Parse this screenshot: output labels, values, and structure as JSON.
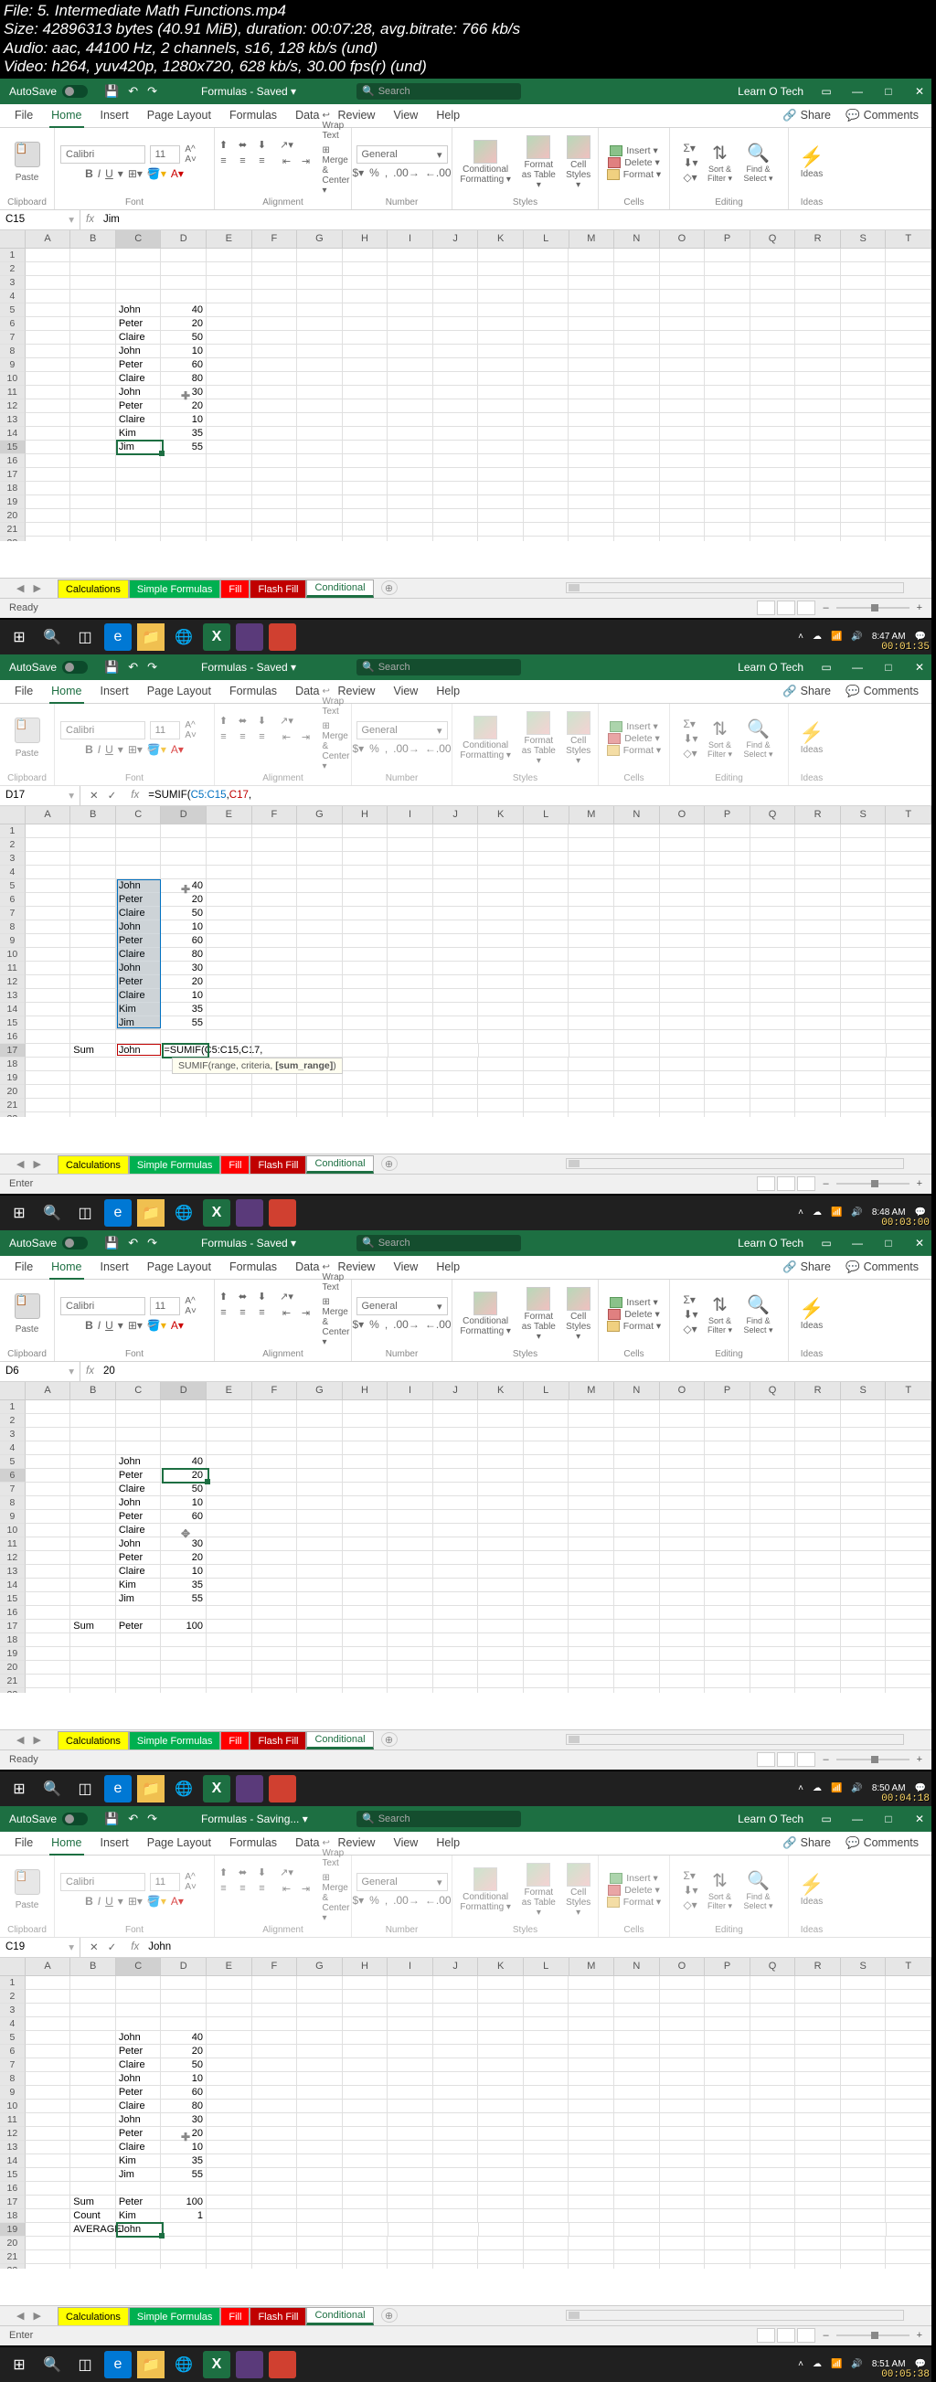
{
  "video_meta": {
    "file": "File: 5. Intermediate Math Functions.mp4",
    "size": "Size: 42896313 bytes (40.91 MiB), duration: 00:07:28, avg.bitrate: 766 kb/s",
    "audio": "Audio: aac, 44100 Hz, 2 channels, s16, 128 kb/s (und)",
    "video": "Video: h264, yuv420p, 1280x720, 628 kb/s, 30.00 fps(r) (und)"
  },
  "common": {
    "autosave_label": "AutoSave",
    "doc_title": "Formulas - Saved ▾",
    "doc_title_saving": "Formulas - Saving... ▾",
    "search_placeholder": "Search",
    "account": "Learn O Tech",
    "share_label": "Share",
    "comments_label": "Comments",
    "tabs": [
      "File",
      "Home",
      "Insert",
      "Page Layout",
      "Formulas",
      "Data",
      "Review",
      "View",
      "Help"
    ],
    "sheet_tabs": [
      "Calculations",
      "Simple Formulas",
      "Fill",
      "Flash Fill",
      "Conditional"
    ],
    "ribbon_groups": {
      "clipboard": "Clipboard",
      "font": "Font",
      "alignment": "Alignment",
      "number": "Number",
      "styles": "Styles",
      "cells": "Cells",
      "editing": "Editing",
      "ideas": "Ideas"
    },
    "font_name": "Calibri",
    "font_size": "11",
    "number_fmt": "General",
    "wrap_text": "Wrap Text",
    "merge_center": "Merge & Center",
    "cond_fmt": "Conditional Formatting ▾",
    "fmt_table": "Format as Table ▾",
    "cell_styles": "Cell Styles ▾",
    "insert_c": "Insert ▾",
    "delete_c": "Delete ▾",
    "format_c": "Format ▾",
    "sort_filter": "Sort & Filter ▾",
    "find_select": "Find & Select ▾",
    "ideas_btn": "Ideas",
    "paste": "Paste"
  },
  "cols": [
    "A",
    "B",
    "C",
    "D",
    "E",
    "F",
    "G",
    "H",
    "I",
    "J",
    "K",
    "L",
    "M",
    "N",
    "O",
    "P",
    "Q",
    "R",
    "S",
    "T"
  ],
  "panel1": {
    "namebox": "C15",
    "formula": "Jim",
    "active": {
      "col": 2,
      "row": 14,
      "w": 1
    },
    "cursor": {
      "col": 3,
      "row": 10
    },
    "data_rows": [
      {
        "r": 5,
        "c": "John",
        "d": "40"
      },
      {
        "r": 6,
        "c": "Peter",
        "d": "20"
      },
      {
        "r": 7,
        "c": "Claire",
        "d": "50"
      },
      {
        "r": 8,
        "c": "John",
        "d": "10"
      },
      {
        "r": 9,
        "c": "Peter",
        "d": "60"
      },
      {
        "r": 10,
        "c": "Claire",
        "d": "80"
      },
      {
        "r": 11,
        "c": "John",
        "d": "30"
      },
      {
        "r": 12,
        "c": "Peter",
        "d": "20"
      },
      {
        "r": 13,
        "c": "Claire",
        "d": "10"
      },
      {
        "r": 14,
        "c": "Kim",
        "d": "35"
      },
      {
        "r": 15,
        "c": "Jim",
        "d": "55"
      }
    ],
    "status": "Ready",
    "time": "8:47 AM",
    "vidtime": "00:01:35"
  },
  "panel2": {
    "namebox": "D17",
    "formula_parts": {
      "pre": "=SUMIF(",
      "r1": "C5:C15",
      "mid": ",",
      "r2": "C17",
      "post": ","
    },
    "tip": {
      "fn": "SUMIF",
      "sig": "(range, criteria, ",
      "bold": "[sum_range]",
      "end": ")"
    },
    "active": {
      "col": 3,
      "row": 16,
      "editing": true
    },
    "blue_range": {
      "col": 2,
      "row": 4,
      "rows": 11
    },
    "red_range": {
      "col": 2,
      "row": 16,
      "rows": 1
    },
    "cursor": {
      "col": 3,
      "row": 4
    },
    "data_rows": [
      {
        "r": 5,
        "c": "John",
        "d": "40"
      },
      {
        "r": 6,
        "c": "Peter",
        "d": "20"
      },
      {
        "r": 7,
        "c": "Claire",
        "d": "50"
      },
      {
        "r": 8,
        "c": "John",
        "d": "10"
      },
      {
        "r": 9,
        "c": "Peter",
        "d": "60"
      },
      {
        "r": 10,
        "c": "Claire",
        "d": "80"
      },
      {
        "r": 11,
        "c": "John",
        "d": "30"
      },
      {
        "r": 12,
        "c": "Peter",
        "d": "20"
      },
      {
        "r": 13,
        "c": "Claire",
        "d": "10"
      },
      {
        "r": 14,
        "c": "Kim",
        "d": "35"
      },
      {
        "r": 15,
        "c": "Jim",
        "d": "55"
      },
      {
        "r": 17,
        "b": "Sum",
        "c": "John",
        "d_formula": "=SUMIF(C5:C15,C17,"
      }
    ],
    "status": "Enter",
    "time": "8:48 AM",
    "vidtime": "00:03:00"
  },
  "panel3": {
    "namebox": "D6",
    "formula": "20",
    "active": {
      "col": 3,
      "row": 5
    },
    "cursor_move": {
      "col": 3,
      "row": 9
    },
    "data_rows": [
      {
        "r": 5,
        "c": "John",
        "d": "40"
      },
      {
        "r": 6,
        "c": "Peter",
        "d": "20"
      },
      {
        "r": 7,
        "c": "Claire",
        "d": "50"
      },
      {
        "r": 8,
        "c": "John",
        "d": "10"
      },
      {
        "r": 9,
        "c": "Peter",
        "d": "60"
      },
      {
        "r": 10,
        "c": "Claire",
        "d": ""
      },
      {
        "r": 11,
        "c": "John",
        "d": "30"
      },
      {
        "r": 12,
        "c": "Peter",
        "d": "20"
      },
      {
        "r": 13,
        "c": "Claire",
        "d": "10"
      },
      {
        "r": 14,
        "c": "Kim",
        "d": "35"
      },
      {
        "r": 15,
        "c": "Jim",
        "d": "55"
      },
      {
        "r": 17,
        "b": "Sum",
        "c": "Peter",
        "d": "100"
      }
    ],
    "status": "Ready",
    "time": "8:50 AM",
    "vidtime": "00:04:18"
  },
  "panel4": {
    "namebox": "C19",
    "formula": "John",
    "active": {
      "col": 2,
      "row": 18
    },
    "cursor": {
      "col": 3,
      "row": 11
    },
    "data_rows": [
      {
        "r": 5,
        "c": "John",
        "d": "40"
      },
      {
        "r": 6,
        "c": "Peter",
        "d": "20"
      },
      {
        "r": 7,
        "c": "Claire",
        "d": "50"
      },
      {
        "r": 8,
        "c": "John",
        "d": "10"
      },
      {
        "r": 9,
        "c": "Peter",
        "d": "60"
      },
      {
        "r": 10,
        "c": "Claire",
        "d": "80"
      },
      {
        "r": 11,
        "c": "John",
        "d": "30"
      },
      {
        "r": 12,
        "c": "Peter",
        "d": "20"
      },
      {
        "r": 13,
        "c": "Claire",
        "d": "10"
      },
      {
        "r": 14,
        "c": "Kim",
        "d": "35"
      },
      {
        "r": 15,
        "c": "Jim",
        "d": "55"
      },
      {
        "r": 17,
        "b": "Sum",
        "c": "Peter",
        "d": "100"
      },
      {
        "r": 18,
        "b": "Count",
        "c": "Kim",
        "d": "1"
      },
      {
        "r": 19,
        "b": "AVERAGE",
        "c": "John",
        "d": ""
      }
    ],
    "status": "Enter",
    "time": "8:51 AM",
    "vidtime": "00:05:38"
  }
}
